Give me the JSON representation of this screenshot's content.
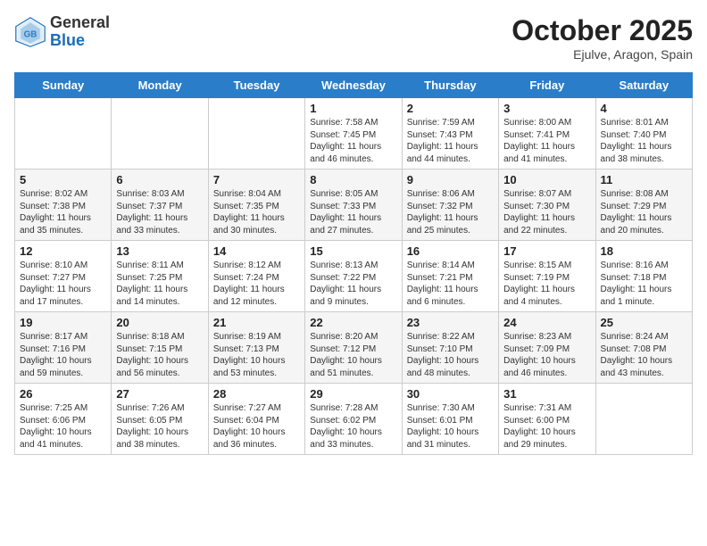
{
  "header": {
    "logo": {
      "general": "General",
      "blue": "Blue"
    },
    "title": "October 2025",
    "subtitle": "Ejulve, Aragon, Spain"
  },
  "weekdays": [
    "Sunday",
    "Monday",
    "Tuesday",
    "Wednesday",
    "Thursday",
    "Friday",
    "Saturday"
  ],
  "weeks": [
    [
      {
        "day": "",
        "sunrise": "",
        "sunset": "",
        "daylight": ""
      },
      {
        "day": "",
        "sunrise": "",
        "sunset": "",
        "daylight": ""
      },
      {
        "day": "",
        "sunrise": "",
        "sunset": "",
        "daylight": ""
      },
      {
        "day": "1",
        "sunrise": "Sunrise: 7:58 AM",
        "sunset": "Sunset: 7:45 PM",
        "daylight": "Daylight: 11 hours and 46 minutes."
      },
      {
        "day": "2",
        "sunrise": "Sunrise: 7:59 AM",
        "sunset": "Sunset: 7:43 PM",
        "daylight": "Daylight: 11 hours and 44 minutes."
      },
      {
        "day": "3",
        "sunrise": "Sunrise: 8:00 AM",
        "sunset": "Sunset: 7:41 PM",
        "daylight": "Daylight: 11 hours and 41 minutes."
      },
      {
        "day": "4",
        "sunrise": "Sunrise: 8:01 AM",
        "sunset": "Sunset: 7:40 PM",
        "daylight": "Daylight: 11 hours and 38 minutes."
      }
    ],
    [
      {
        "day": "5",
        "sunrise": "Sunrise: 8:02 AM",
        "sunset": "Sunset: 7:38 PM",
        "daylight": "Daylight: 11 hours and 35 minutes."
      },
      {
        "day": "6",
        "sunrise": "Sunrise: 8:03 AM",
        "sunset": "Sunset: 7:37 PM",
        "daylight": "Daylight: 11 hours and 33 minutes."
      },
      {
        "day": "7",
        "sunrise": "Sunrise: 8:04 AM",
        "sunset": "Sunset: 7:35 PM",
        "daylight": "Daylight: 11 hours and 30 minutes."
      },
      {
        "day": "8",
        "sunrise": "Sunrise: 8:05 AM",
        "sunset": "Sunset: 7:33 PM",
        "daylight": "Daylight: 11 hours and 27 minutes."
      },
      {
        "day": "9",
        "sunrise": "Sunrise: 8:06 AM",
        "sunset": "Sunset: 7:32 PM",
        "daylight": "Daylight: 11 hours and 25 minutes."
      },
      {
        "day": "10",
        "sunrise": "Sunrise: 8:07 AM",
        "sunset": "Sunset: 7:30 PM",
        "daylight": "Daylight: 11 hours and 22 minutes."
      },
      {
        "day": "11",
        "sunrise": "Sunrise: 8:08 AM",
        "sunset": "Sunset: 7:29 PM",
        "daylight": "Daylight: 11 hours and 20 minutes."
      }
    ],
    [
      {
        "day": "12",
        "sunrise": "Sunrise: 8:10 AM",
        "sunset": "Sunset: 7:27 PM",
        "daylight": "Daylight: 11 hours and 17 minutes."
      },
      {
        "day": "13",
        "sunrise": "Sunrise: 8:11 AM",
        "sunset": "Sunset: 7:25 PM",
        "daylight": "Daylight: 11 hours and 14 minutes."
      },
      {
        "day": "14",
        "sunrise": "Sunrise: 8:12 AM",
        "sunset": "Sunset: 7:24 PM",
        "daylight": "Daylight: 11 hours and 12 minutes."
      },
      {
        "day": "15",
        "sunrise": "Sunrise: 8:13 AM",
        "sunset": "Sunset: 7:22 PM",
        "daylight": "Daylight: 11 hours and 9 minutes."
      },
      {
        "day": "16",
        "sunrise": "Sunrise: 8:14 AM",
        "sunset": "Sunset: 7:21 PM",
        "daylight": "Daylight: 11 hours and 6 minutes."
      },
      {
        "day": "17",
        "sunrise": "Sunrise: 8:15 AM",
        "sunset": "Sunset: 7:19 PM",
        "daylight": "Daylight: 11 hours and 4 minutes."
      },
      {
        "day": "18",
        "sunrise": "Sunrise: 8:16 AM",
        "sunset": "Sunset: 7:18 PM",
        "daylight": "Daylight: 11 hours and 1 minute."
      }
    ],
    [
      {
        "day": "19",
        "sunrise": "Sunrise: 8:17 AM",
        "sunset": "Sunset: 7:16 PM",
        "daylight": "Daylight: 10 hours and 59 minutes."
      },
      {
        "day": "20",
        "sunrise": "Sunrise: 8:18 AM",
        "sunset": "Sunset: 7:15 PM",
        "daylight": "Daylight: 10 hours and 56 minutes."
      },
      {
        "day": "21",
        "sunrise": "Sunrise: 8:19 AM",
        "sunset": "Sunset: 7:13 PM",
        "daylight": "Daylight: 10 hours and 53 minutes."
      },
      {
        "day": "22",
        "sunrise": "Sunrise: 8:20 AM",
        "sunset": "Sunset: 7:12 PM",
        "daylight": "Daylight: 10 hours and 51 minutes."
      },
      {
        "day": "23",
        "sunrise": "Sunrise: 8:22 AM",
        "sunset": "Sunset: 7:10 PM",
        "daylight": "Daylight: 10 hours and 48 minutes."
      },
      {
        "day": "24",
        "sunrise": "Sunrise: 8:23 AM",
        "sunset": "Sunset: 7:09 PM",
        "daylight": "Daylight: 10 hours and 46 minutes."
      },
      {
        "day": "25",
        "sunrise": "Sunrise: 8:24 AM",
        "sunset": "Sunset: 7:08 PM",
        "daylight": "Daylight: 10 hours and 43 minutes."
      }
    ],
    [
      {
        "day": "26",
        "sunrise": "Sunrise: 7:25 AM",
        "sunset": "Sunset: 6:06 PM",
        "daylight": "Daylight: 10 hours and 41 minutes."
      },
      {
        "day": "27",
        "sunrise": "Sunrise: 7:26 AM",
        "sunset": "Sunset: 6:05 PM",
        "daylight": "Daylight: 10 hours and 38 minutes."
      },
      {
        "day": "28",
        "sunrise": "Sunrise: 7:27 AM",
        "sunset": "Sunset: 6:04 PM",
        "daylight": "Daylight: 10 hours and 36 minutes."
      },
      {
        "day": "29",
        "sunrise": "Sunrise: 7:28 AM",
        "sunset": "Sunset: 6:02 PM",
        "daylight": "Daylight: 10 hours and 33 minutes."
      },
      {
        "day": "30",
        "sunrise": "Sunrise: 7:30 AM",
        "sunset": "Sunset: 6:01 PM",
        "daylight": "Daylight: 10 hours and 31 minutes."
      },
      {
        "day": "31",
        "sunrise": "Sunrise: 7:31 AM",
        "sunset": "Sunset: 6:00 PM",
        "daylight": "Daylight: 10 hours and 29 minutes."
      },
      {
        "day": "",
        "sunrise": "",
        "sunset": "",
        "daylight": ""
      }
    ]
  ]
}
